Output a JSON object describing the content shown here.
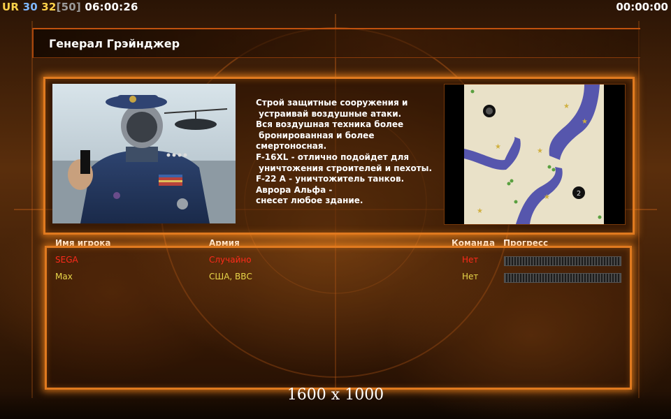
{
  "hud": {
    "ur_label": "UR",
    "ur_value": "30",
    "money": "32",
    "money_max": "[50]",
    "time_left": "06:00:26",
    "time_right": "00:00:00"
  },
  "title": "Генерал Грэйнджер",
  "description": "Строй защитные сооружения и\n устраивай воздушные атаки.\nВся воздушная техника более\n бронированная и более\nсмертоносная.\nF-16XL - отлично подойдет для\n уничтожения строителей и пехоты.\nF-22 A - уничтожитель танков.\nАврора Альфа -\nснесет любое здание.",
  "minimap": {
    "start_marker_1": "1",
    "start_marker_2": "2"
  },
  "table": {
    "headers": {
      "player": "Имя игрока",
      "army": "Армия",
      "team": "Команда",
      "progress": "Прогресс"
    },
    "rows": [
      {
        "name": "SEGA",
        "army": "Случайно",
        "team": "Нет",
        "color": "#ff2a1a",
        "progress": 1.0
      },
      {
        "name": "Max",
        "army": "США, ВВС",
        "team": "Нет",
        "color": "#e8d64a",
        "progress": 1.0
      }
    ]
  },
  "resolution": "1600 x 1000",
  "colors": {
    "accent": "#e07a1f",
    "hud_ur": "#ffd24a",
    "hud_ur_value": "#7fb8ff",
    "hud_money": "#ffd24a",
    "hud_money_max": "#9a9a9a"
  }
}
